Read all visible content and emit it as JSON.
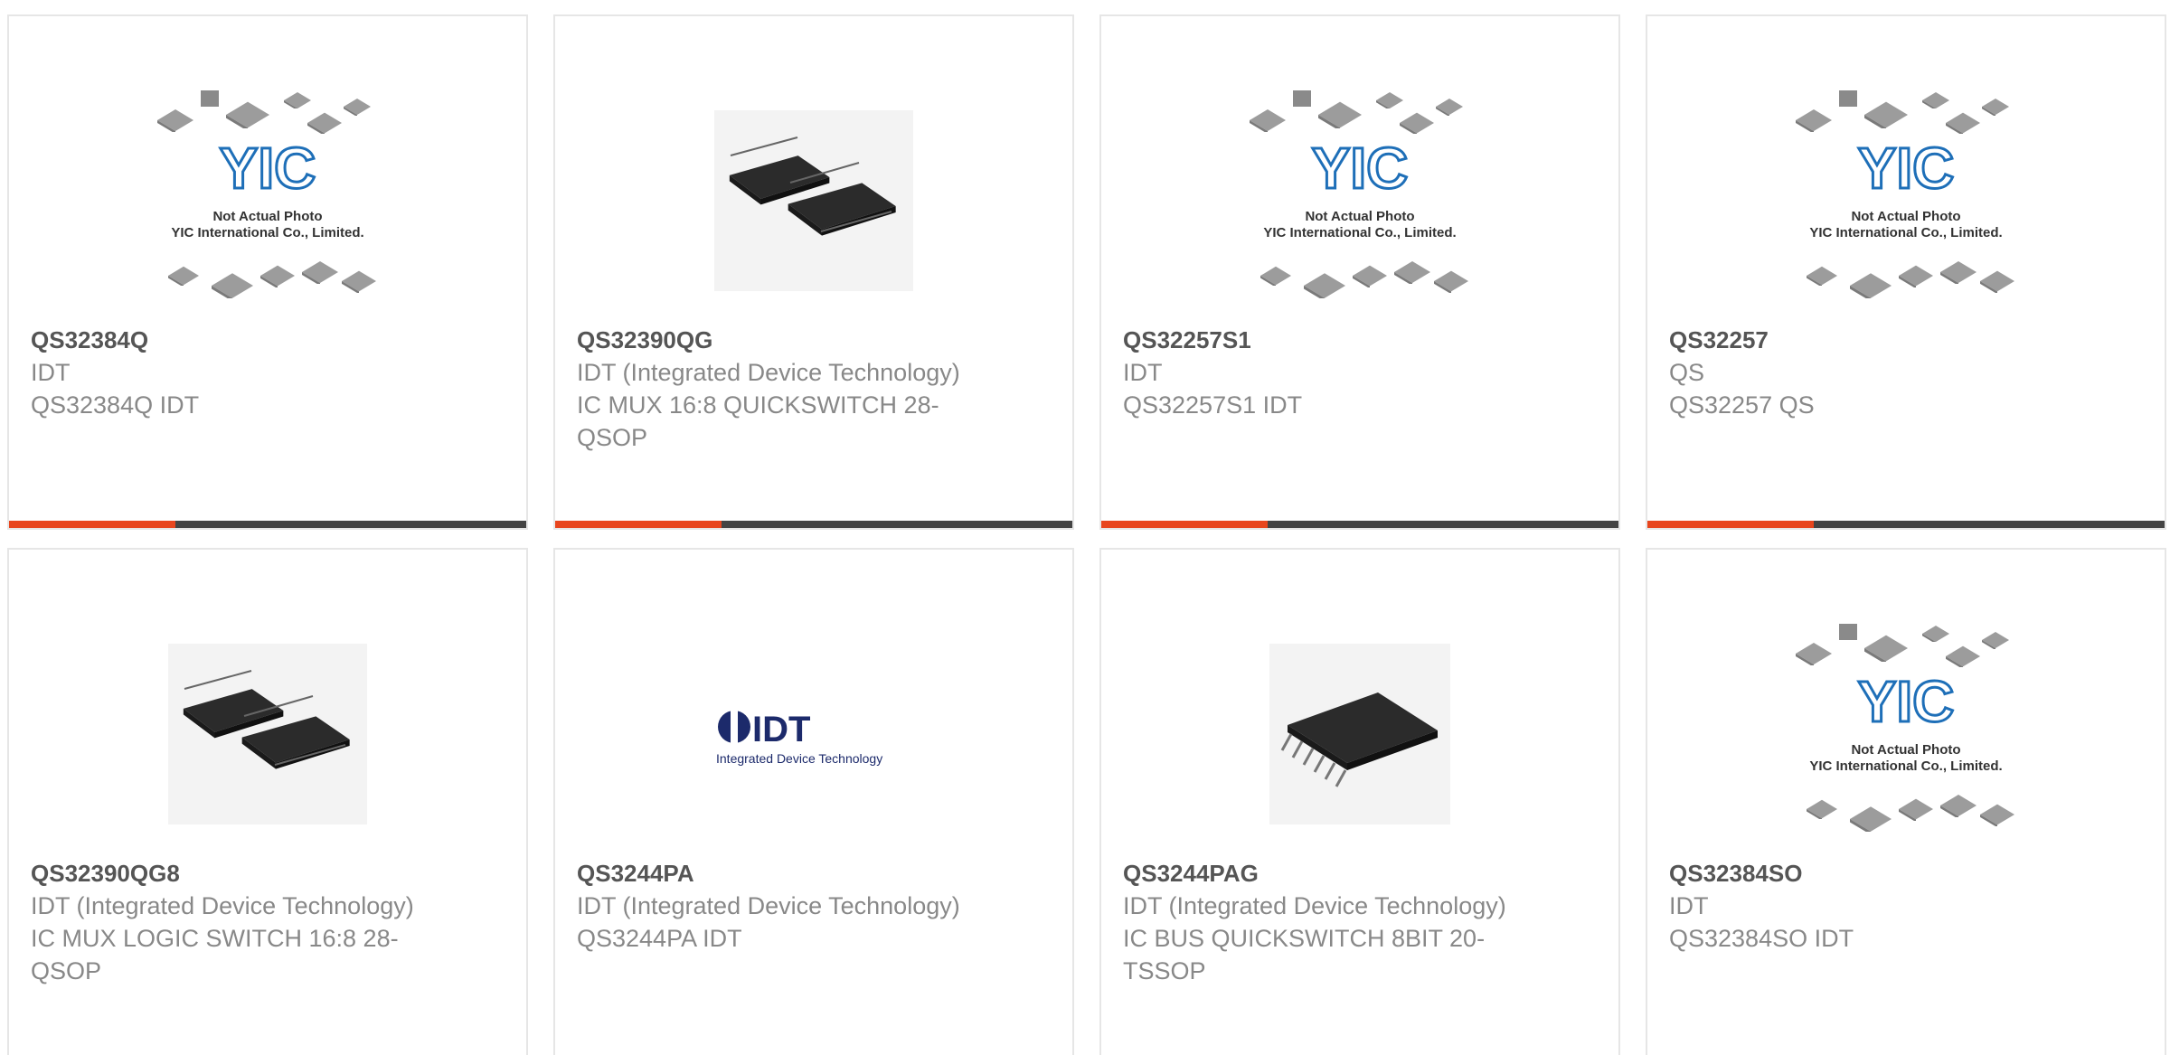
{
  "products": [
    {
      "part_number": "QS32384Q",
      "manufacturer": "IDT",
      "description": "QS32384Q IDT",
      "image": "yic-placeholder",
      "image_caption_line1": "Not Actual Photo",
      "image_caption_line2": "YIC International Co., Limited.",
      "image_logo": "YIC"
    },
    {
      "part_number": "QS32390QG",
      "manufacturer": "IDT (Integrated Device Technology)",
      "description": "IC MUX 16:8 QUICKSWITCH 28-QSOP",
      "image": "ic-chips-photo"
    },
    {
      "part_number": "QS32257S1",
      "manufacturer": "IDT",
      "description": "QS32257S1 IDT",
      "image": "yic-placeholder",
      "image_caption_line1": "Not Actual Photo",
      "image_caption_line2": "YIC International Co., Limited.",
      "image_logo": "YIC"
    },
    {
      "part_number": "QS32257",
      "manufacturer": "QS",
      "description": "QS32257 QS",
      "image": "yic-placeholder",
      "image_caption_line1": "Not Actual Photo",
      "image_caption_line2": "YIC International Co., Limited.",
      "image_logo": "YIC"
    },
    {
      "part_number": "QS32390QG8",
      "manufacturer": "IDT (Integrated Device Technology)",
      "description": "IC MUX LOGIC SWITCH 16:8 28-QSOP",
      "image": "ic-chips-photo"
    },
    {
      "part_number": "QS3244PA",
      "manufacturer": "IDT (Integrated Device Technology)",
      "description": "QS3244PA IDT",
      "image": "idt-logo",
      "image_logo": "IDT",
      "image_logo_tagline": "Integrated Device Technology"
    },
    {
      "part_number": "QS3244PAG",
      "manufacturer": "IDT (Integrated Device Technology)",
      "description": "IC BUS QUICKSWITCH 8BIT 20-TSSOP",
      "image": "tssop-chip-photo"
    },
    {
      "part_number": "QS32384SO",
      "manufacturer": "IDT",
      "description": "QS32384SO IDT",
      "image": "yic-placeholder",
      "image_caption_line1": "Not Actual Photo",
      "image_caption_line2": "YIC International Co., Limited.",
      "image_logo": "YIC"
    }
  ],
  "colors": {
    "accent": "#e8461e",
    "bar": "#444444",
    "part_number": "#555555",
    "secondary_text": "#888888",
    "yic_blue": "#1e6fb8"
  }
}
